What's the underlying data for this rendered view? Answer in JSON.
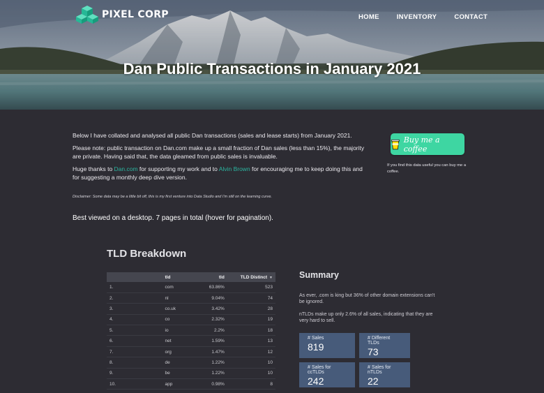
{
  "brand": {
    "name": "PIXEL CORP"
  },
  "nav": {
    "items": [
      "HOME",
      "INVENTORY",
      "CONTACT"
    ]
  },
  "hero": {
    "title": "Dan Public Transactions in January 2021"
  },
  "intro": {
    "p1": "Below I have collated and analysed all public Dan transactions (sales and lease starts) from January 2021.",
    "p2": "Please note: public transaction on Dan.com make up a small fraction of Dan sales (less than 15%), the majority are private. Having said that, the data gleamed from public sales is invaluable.",
    "p3_pre": "Huge thanks to ",
    "p3_link1": "Dan.com",
    "p3_mid": " for supporting my work and to ",
    "p3_link2": "Alvin Brown",
    "p3_post": " for encouraging me to keep doing this and for suggesting a monthly deep dive version.",
    "disclaimer": "Disclaimer: Some data may be a little bit off, this is my first venture into Data Studio and I'm still on the learning curve.",
    "best_viewed": "Best viewed on a desktop. 7 pages in total (hover for pagination)."
  },
  "coffee": {
    "button_label": "Buy me a coffee",
    "note": "If you find this data useful you can buy me a coffee.",
    "accent": "#3ed6a2"
  },
  "tld": {
    "heading": "TLD Breakdown",
    "columns": [
      "",
      "tld",
      "tld",
      "TLD Distinct"
    ],
    "rows": [
      [
        "1.",
        "com",
        "63.86%",
        "523"
      ],
      [
        "2.",
        "nl",
        "9.04%",
        "74"
      ],
      [
        "3.",
        "co.uk",
        "3.42%",
        "28"
      ],
      [
        "4.",
        "co",
        "2.32%",
        "19"
      ],
      [
        "5.",
        "io",
        "2.2%",
        "18"
      ],
      [
        "6.",
        "net",
        "1.59%",
        "13"
      ],
      [
        "7.",
        "org",
        "1.47%",
        "12"
      ],
      [
        "8.",
        "de",
        "1.22%",
        "10"
      ],
      [
        "9.",
        "be",
        "1.22%",
        "10"
      ],
      [
        "10.",
        "app",
        "0.98%",
        "8"
      ]
    ]
  },
  "summary": {
    "heading": "Summary",
    "p1": "As ever, .com is king but 36% of other domain extensions can't be ignored.",
    "p2": "nTLDs make up only 2.6% of all sales, indicating that they are very hard to sell.",
    "cards": [
      {
        "label": "# Sales",
        "value": "819"
      },
      {
        "label": "# Different TLDs",
        "value": "73"
      },
      {
        "label": "# Sales for ccTLDs",
        "value": "242"
      },
      {
        "label": "# Sales for nTLDs",
        "value": "22"
      }
    ],
    "card_color": "#475b7a"
  }
}
